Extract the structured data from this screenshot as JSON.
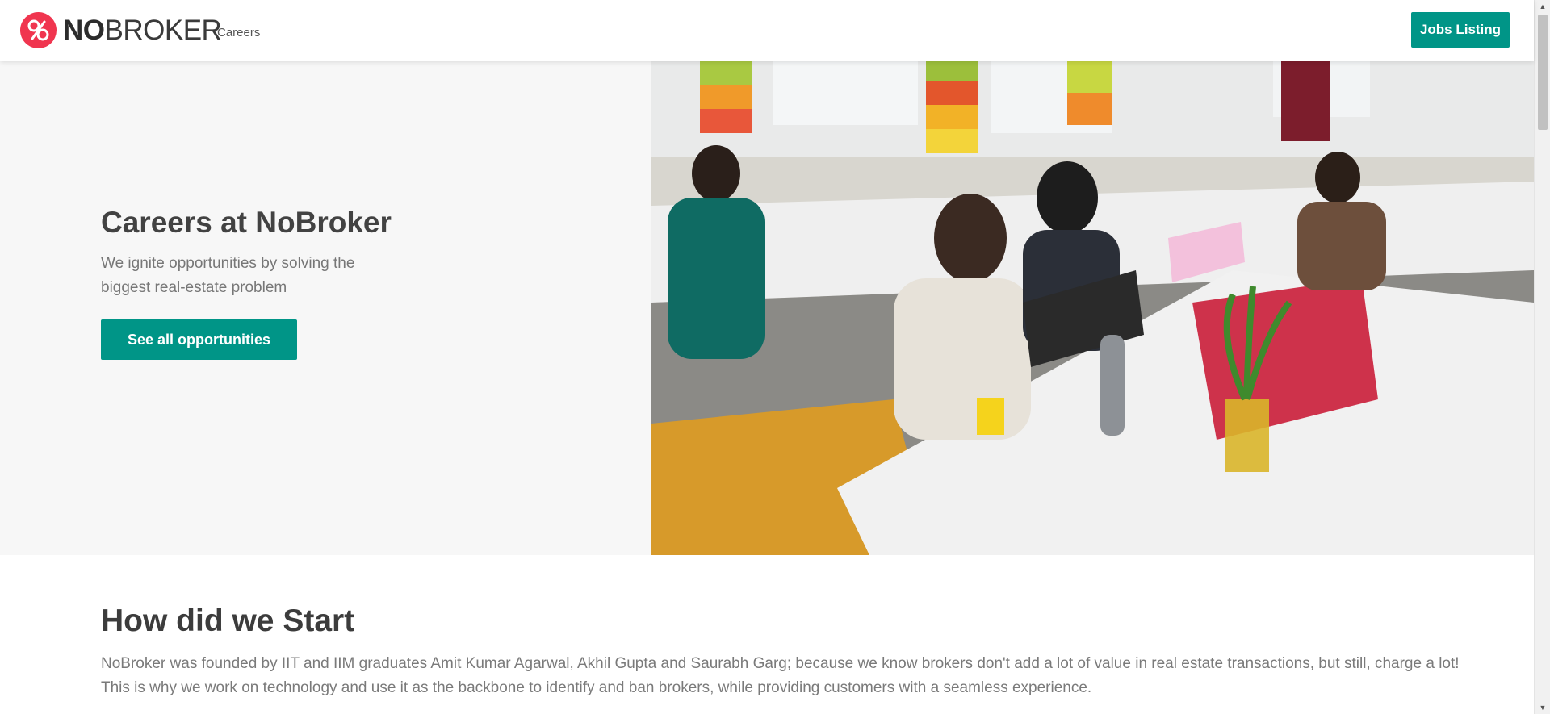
{
  "header": {
    "logo_no": "NO",
    "logo_broker": "BROKER",
    "logo_sub": "Careers",
    "jobs_button": "Jobs Listing"
  },
  "hero": {
    "title": "Careers at NoBroker",
    "subtitle": "We ignite opportunities by solving the biggest real-estate problem",
    "cta": "See all opportunities"
  },
  "story": {
    "title": "How did we Start",
    "text": "NoBroker was founded by IIT and IIM graduates Amit Kumar Agarwal, Akhil Gupta and Saurabh Garg; because we know brokers don't add a lot of value in real estate transactions, but still, charge a lot! This is why we work on technology and use it as the backbone to identify and ban brokers, while providing customers with a seamless experience."
  },
  "colors": {
    "brand_red": "#f0354f",
    "accent_teal": "#009587"
  },
  "scrollbar": {
    "up_icon": "▲",
    "down_icon": "▼"
  }
}
